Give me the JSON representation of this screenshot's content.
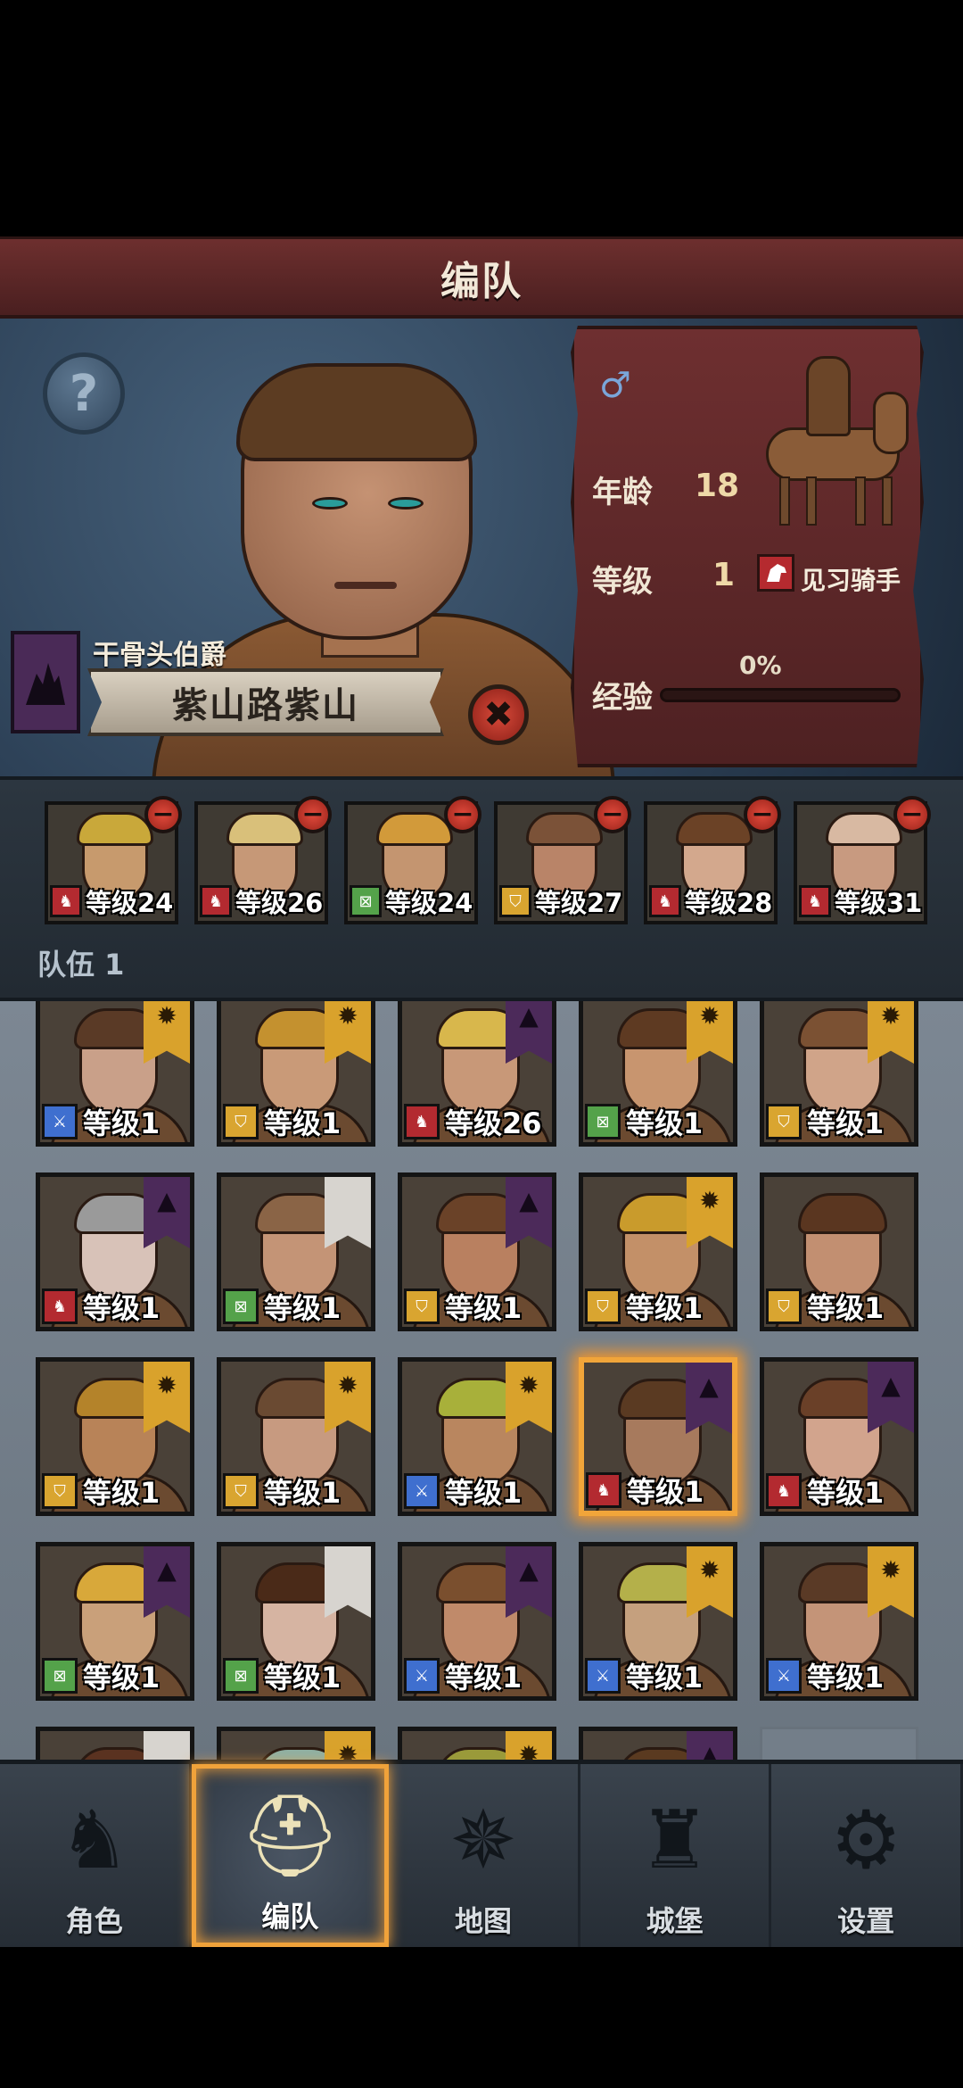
{
  "header": {
    "title": "编队"
  },
  "hero": {
    "help_symbol": "?",
    "house_name": "干骨头伯爵",
    "character_name": "紫山路紫山",
    "dismiss_symbol": "✖",
    "stats": {
      "gender_symbol": "♂",
      "age_label": "年龄",
      "age_value": "18",
      "level_label": "等级",
      "level_value": "1",
      "class_name": "见习骑手",
      "exp_label": "经验",
      "exp_percent_text": "0%",
      "exp_fraction": 0
    }
  },
  "team": {
    "label": "队伍 1",
    "members": [
      {
        "cls": "cavalry",
        "level": "等级24",
        "skin": "#c79a6d",
        "hair": "#c9a83a"
      },
      {
        "cls": "cavalry",
        "level": "等级26",
        "skin": "#c69877",
        "hair": "#d9c07a"
      },
      {
        "cls": "bow",
        "level": "等级24",
        "skin": "#c49570",
        "hair": "#d29a3a"
      },
      {
        "cls": "shield",
        "level": "等级27",
        "skin": "#b98468",
        "hair": "#7b5238"
      },
      {
        "cls": "cavalry",
        "level": "等级28",
        "skin": "#d3a88d",
        "hair": "#6b4226"
      },
      {
        "cls": "cavalry",
        "level": "等级31",
        "skin": "#c89a80",
        "hair": "#d8b9a2"
      }
    ]
  },
  "roster": {
    "rows": [
      [
        {
          "cls": "spear",
          "level": "等级1",
          "flag": "gold",
          "skin": "#c9a089",
          "hair": "#5a3a26"
        },
        {
          "cls": "shield",
          "level": "等级1",
          "flag": "gold",
          "skin": "#c99a78",
          "hair": "#c4912f"
        },
        {
          "cls": "cavalry",
          "level": "等级26",
          "flag": "purple",
          "skin": "#c89878",
          "hair": "#d8b74c"
        },
        {
          "cls": "bow",
          "level": "等级1",
          "flag": "gold",
          "skin": "#c8956f",
          "hair": "#5e3a22"
        },
        {
          "cls": "shield",
          "level": "等级1",
          "flag": "gold",
          "skin": "#d0a489",
          "hair": "#7b5133"
        }
      ],
      [
        {
          "cls": "cavalry",
          "level": "等级1",
          "flag": "purple",
          "skin": "#d8c2b8",
          "hair": "#9a9a9a"
        },
        {
          "cls": "bow",
          "level": "等级1",
          "flag": "white",
          "skin": "#c49476",
          "hair": "#8a6446"
        },
        {
          "cls": "shield",
          "level": "等级1",
          "flag": "purple",
          "skin": "#b98060",
          "hair": "#6a4228"
        },
        {
          "cls": "shield",
          "level": "等级1",
          "flag": "gold",
          "skin": "#c39068",
          "hair": "#c99b2c"
        },
        {
          "cls": "shield",
          "level": "等级1",
          "flag": "none",
          "skin": "#c28f71",
          "hair": "#5a3620"
        }
      ],
      [
        {
          "cls": "shield",
          "level": "等级1",
          "flag": "gold",
          "skin": "#b88358",
          "hair": "#b4832a"
        },
        {
          "cls": "shield",
          "level": "等级1",
          "flag": "gold",
          "skin": "#c79a80",
          "hair": "#6a4a32"
        },
        {
          "cls": "spear",
          "level": "等级1",
          "flag": "gold",
          "skin": "#b9865f",
          "hair": "#a8b03a"
        },
        {
          "cls": "cavalry",
          "level": "等级1",
          "flag": "purple",
          "skin": "#a77a5d",
          "hair": "#5a3a22",
          "selected": true
        },
        {
          "cls": "cavalry",
          "level": "等级1",
          "flag": "purple",
          "skin": "#d2a48d",
          "hair": "#6a4028"
        }
      ],
      [
        {
          "cls": "bow",
          "level": "等级1",
          "flag": "purple",
          "skin": "#c9a07a",
          "hair": "#d8a83a"
        },
        {
          "cls": "bow",
          "level": "等级1",
          "flag": "white",
          "skin": "#d6b4a2",
          "hair": "#4a2a18"
        },
        {
          "cls": "spear",
          "level": "等级1",
          "flag": "purple",
          "skin": "#c08a6a",
          "hair": "#7a4f2e"
        },
        {
          "cls": "spear",
          "level": "等级1",
          "flag": "gold",
          "skin": "#c5a07e",
          "hair": "#b4b04a"
        },
        {
          "cls": "spear",
          "level": "等级1",
          "flag": "gold",
          "skin": "#c49478",
          "hair": "#5a3a26"
        }
      ],
      [
        {
          "cls": "none",
          "level": "",
          "flag": "white",
          "skin": "#b88a6a",
          "hair": "#5a3220"
        },
        {
          "cls": "none",
          "level": "",
          "flag": "gold",
          "skin": "#c9a892",
          "hair": "#8fb0a4"
        },
        {
          "cls": "none",
          "level": "",
          "flag": "gold",
          "skin": "#bd8c6b",
          "hair": "#9a9a3a"
        },
        {
          "cls": "none",
          "level": "",
          "flag": "purple",
          "skin": "#bb8b66",
          "hair": "#5a3a20"
        },
        {
          "cls": "empty"
        }
      ]
    ]
  },
  "nav": {
    "items": [
      {
        "key": "character",
        "label": "角色",
        "icon": "knight-icon",
        "glyph": "♞"
      },
      {
        "key": "formation",
        "label": "编队",
        "icon": "helmet-icon",
        "glyph": "⛑",
        "active": true
      },
      {
        "key": "map",
        "label": "地图",
        "icon": "compass-icon",
        "glyph": "✵"
      },
      {
        "key": "castle",
        "label": "城堡",
        "icon": "castle-icon",
        "glyph": "♜"
      },
      {
        "key": "settings",
        "label": "设置",
        "icon": "gear-icon",
        "glyph": "⚙"
      }
    ]
  },
  "colors": {
    "accent_orange": "#f1a53a",
    "banner_purple": "#4c2a5a",
    "banner_gold": "#d9a22c",
    "title_red": "#6d2f2e"
  }
}
